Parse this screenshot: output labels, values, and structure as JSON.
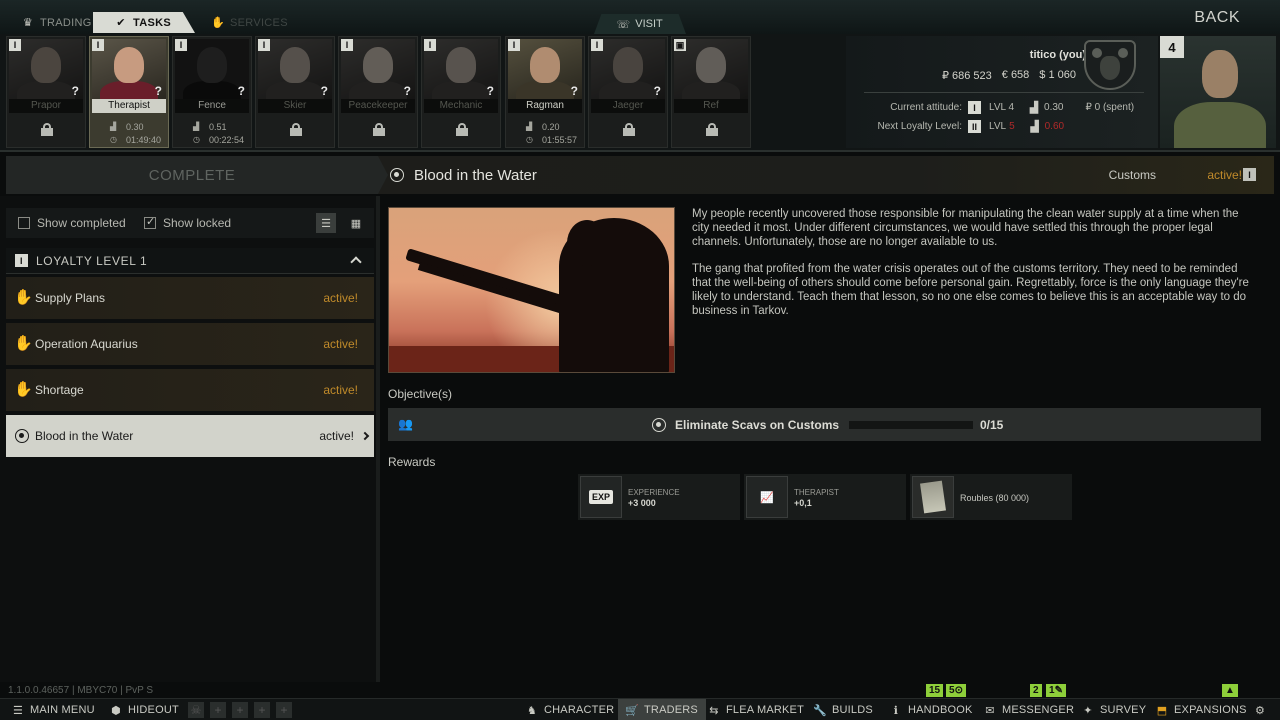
{
  "top_tabs": [
    {
      "label": "TRADING",
      "icon": "crown-icon"
    },
    {
      "label": "TASKS",
      "icon": "check-circle-icon"
    },
    {
      "label": "SERVICES",
      "icon": "handshake-icon"
    }
  ],
  "visit_label": "VISIT",
  "back_label": "BACK",
  "traders": [
    {
      "name": "Prapor",
      "level_badge": "I",
      "locked": true
    },
    {
      "name": "Therapist",
      "level_badge": "I",
      "locked": false,
      "standing": "0.30",
      "timer": "01:49:40"
    },
    {
      "name": "Fence",
      "level_badge": "I",
      "locked": false,
      "standing": "0.51",
      "timer": "00:22:54"
    },
    {
      "name": "Skier",
      "level_badge": "I",
      "locked": true
    },
    {
      "name": "Peacekeeper",
      "level_badge": "I",
      "locked": true
    },
    {
      "name": "Mechanic",
      "level_badge": "I",
      "locked": true
    },
    {
      "name": "Ragman",
      "level_badge": "I",
      "locked": false,
      "standing": "0.20",
      "timer": "01:55:57"
    },
    {
      "name": "Jaeger",
      "level_badge": "I",
      "locked": true
    },
    {
      "name": "Ref",
      "level_badge": "",
      "locked": true
    }
  ],
  "player": {
    "name": "titico (you)",
    "roubles": "₽ 686 523",
    "euros": "€ 658",
    "dollars": "$ 1 060",
    "level": "4",
    "current_attitude_label": "Current attitude:",
    "current_badge": "I",
    "current_lvl": "LVL 4",
    "current_standing": "0.30",
    "spent": "₽ 0 (spent)",
    "next_loyalty_label": "Next Loyalty Level:",
    "next_badge": "II",
    "next_lvl": "LVL",
    "next_lvl_req": "5",
    "next_standing_req": "0.60"
  },
  "left": {
    "complete_label": "COMPLETE",
    "show_completed": "Show completed",
    "show_locked": "Show locked",
    "loyalty_header": "LOYALTY LEVEL 1",
    "loyalty_badge": "I",
    "quests": [
      {
        "name": "Supply Plans",
        "status": "active!"
      },
      {
        "name": "Operation Aquarius",
        "status": "active!"
      },
      {
        "name": "Shortage",
        "status": "active!"
      },
      {
        "name": "Blood in the Water",
        "status": "active!"
      }
    ]
  },
  "task": {
    "title": "Blood in the Water",
    "location": "Customs",
    "status": "active!",
    "status_badge": "I",
    "description": [
      "My people recently uncovered those responsible for manipulating the clean water supply at a time when the city needed it most. Under different circumstances, we would have settled this through the proper legal channels. Unfortunately, those are no longer available to us.",
      "The gang that profited from the water crisis operates out of the customs territory. They need to be reminded that the well-being of others should come before personal gain. Regrettably, force is the only language they're likely to understand. Teach them that lesson, so no one else comes to believe this is an acceptable way to do business in Tarkov."
    ],
    "objectives_label": "Objective(s)",
    "objective": {
      "text": "Eliminate Scavs on Customs",
      "count": "0/15",
      "progress": 0
    },
    "rewards_label": "Rewards",
    "rewards": [
      {
        "label": "EXPERIENCE",
        "value": "+3 000",
        "icon": "EXP"
      },
      {
        "label": "THERAPIST",
        "value": "+0,1"
      },
      {
        "text": "Roubles (80 000)"
      }
    ]
  },
  "version": "1.1.0.0.46657 | MBYC70 | PvP S",
  "indicators": {
    "a": "15",
    "b": "5",
    "c": "2",
    "d": "1"
  },
  "bottom_nav": {
    "main_menu": "MAIN MENU",
    "hideout": "HIDEOUT",
    "character": "CHARACTER",
    "traders": "TRADERS",
    "flea_market": "FLEA MARKET",
    "builds": "BUILDS",
    "handbook": "HANDBOOK",
    "messenger": "MESSENGER",
    "survey": "SURVEY",
    "expansions": "EXPANSIONS"
  },
  "colors": {
    "accent_orange": "#c08a2a",
    "accent_green": "#8ecf3a",
    "danger_red": "#b02a2a"
  }
}
